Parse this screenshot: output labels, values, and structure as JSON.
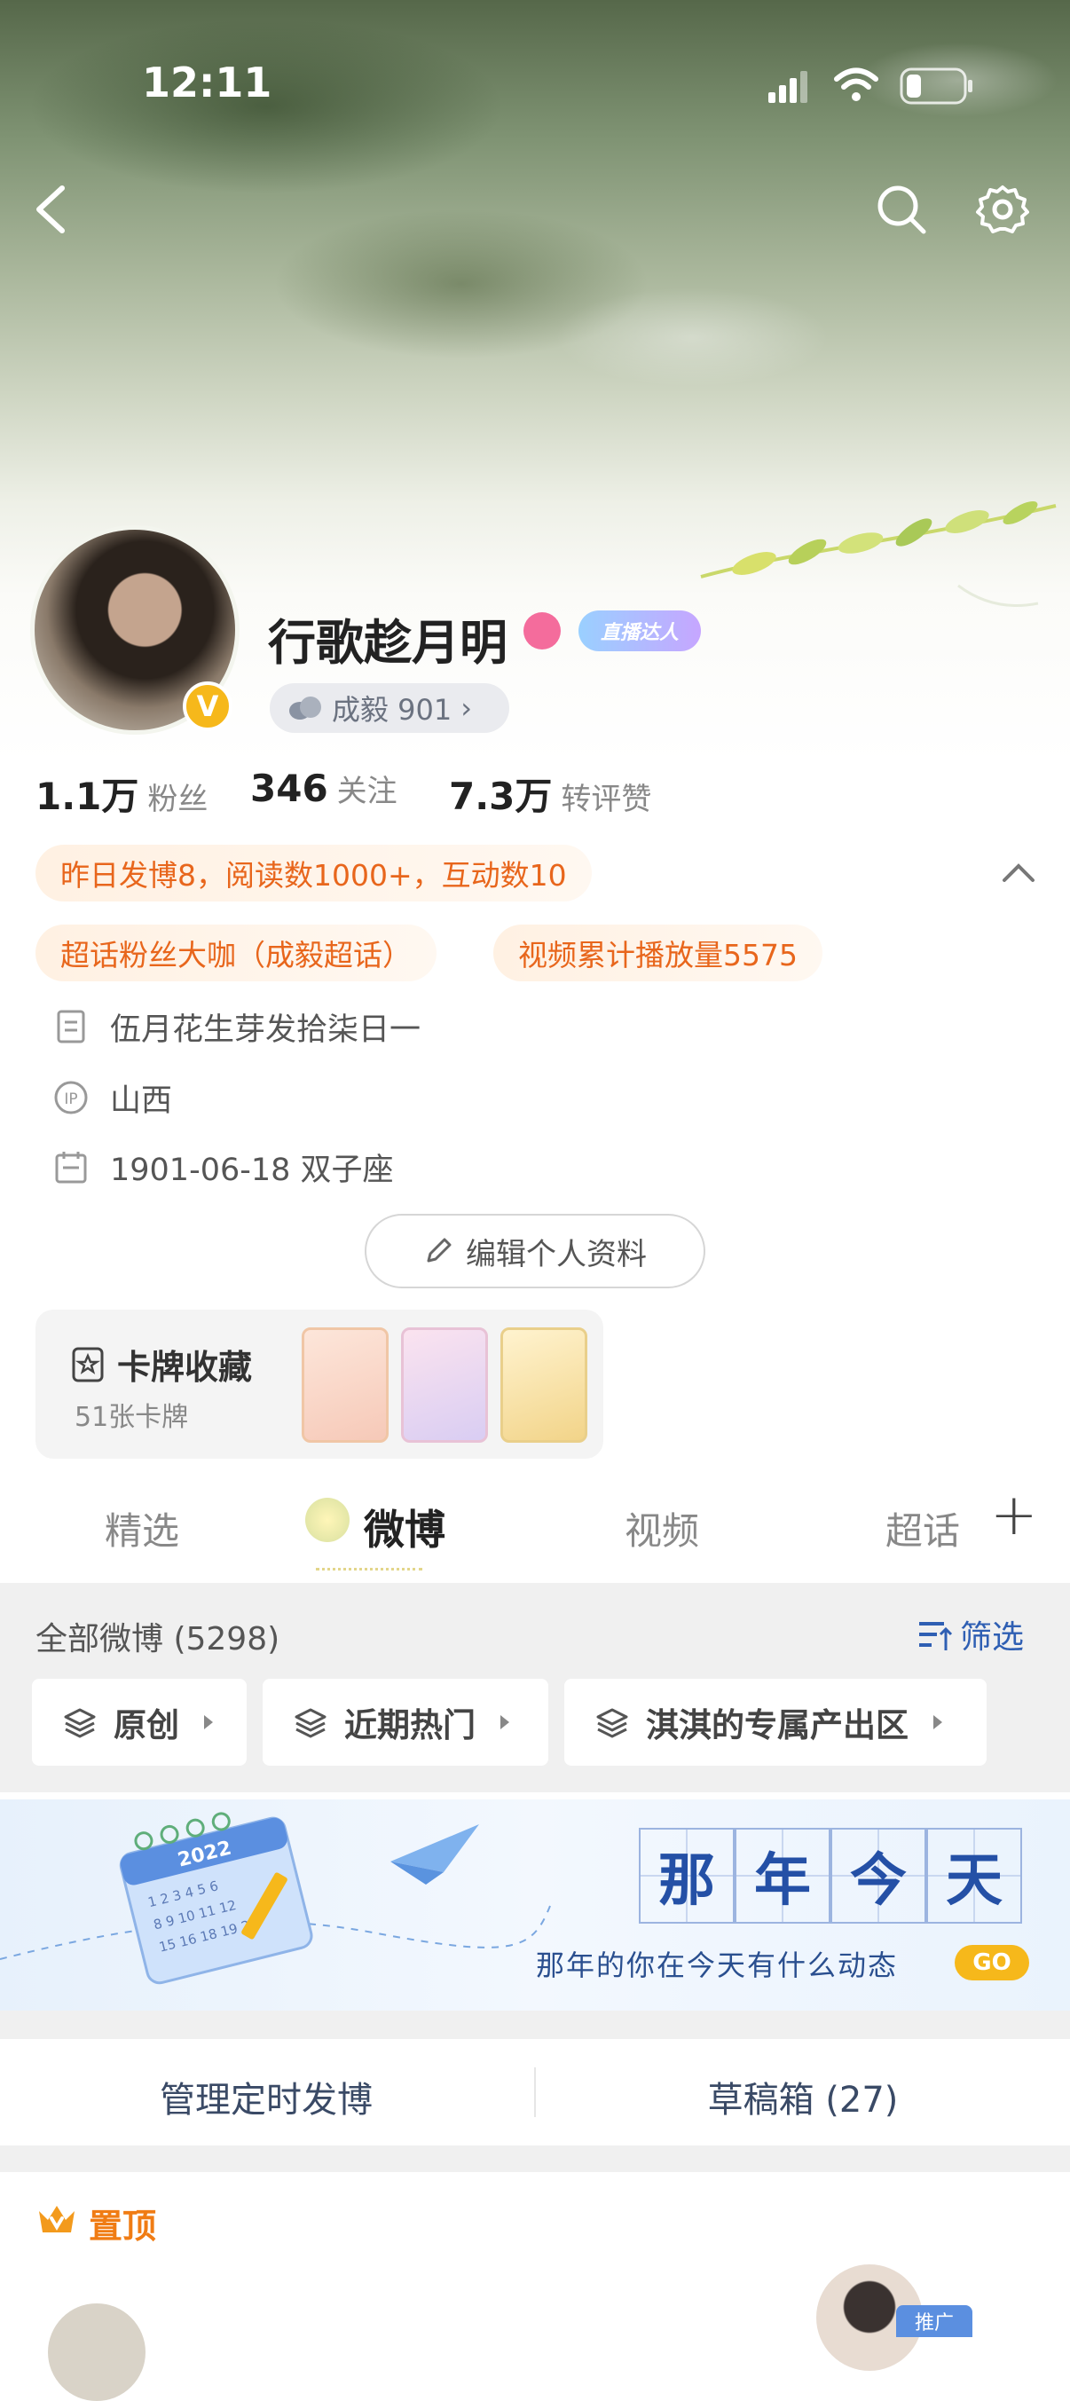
{
  "status_bar": {
    "time": "12:11"
  },
  "profile": {
    "username": "行歌趁月明",
    "live_badge": "直播达人",
    "verified_badge": "V",
    "fan_group": "成毅 901",
    "fan_group_chevron": "›"
  },
  "stats": [
    {
      "value": "1.1万",
      "label": "粉丝"
    },
    {
      "value": "346",
      "label": "关注"
    },
    {
      "value": "7.3万",
      "label": "转评赞"
    }
  ],
  "tags": {
    "yesterday": "昨日发博8，阅读数1000+，互动数10",
    "super_fan": "超话粉丝大咖（成毅超话）",
    "video_plays": "视频累计播放量5575"
  },
  "info": {
    "bio": "伍月花生芽发拾柒日一",
    "ip_badge": "IP",
    "ip_location": "山西",
    "birthday": "1901-06-18 双子座"
  },
  "edit_button": "编辑个人资料",
  "card_collection": {
    "title": "卡牌收藏",
    "count": "51张卡牌"
  },
  "tabs": [
    "精选",
    "微博",
    "视频",
    "超话"
  ],
  "tab_add": "+",
  "weibo_list": {
    "all_label": "全部微博 (5298)",
    "filter_label": "筛选",
    "filter_buttons": [
      "原创",
      "近期热门",
      "淇淇的专属产出区"
    ]
  },
  "banner": {
    "year": "2022",
    "title_chars": [
      "那",
      "年",
      "今",
      "天"
    ],
    "subtitle": "那年的你在今天有什么动态",
    "go": "GO"
  },
  "manage": {
    "schedule": "管理定时发博",
    "drafts": "草稿箱 (27)"
  },
  "pinned": {
    "label": "置顶",
    "ad_badge": "推广"
  },
  "colors": {
    "orange": "#e8661c",
    "accent_blue": "#2f5fb3",
    "gold": "#f6b81b"
  }
}
